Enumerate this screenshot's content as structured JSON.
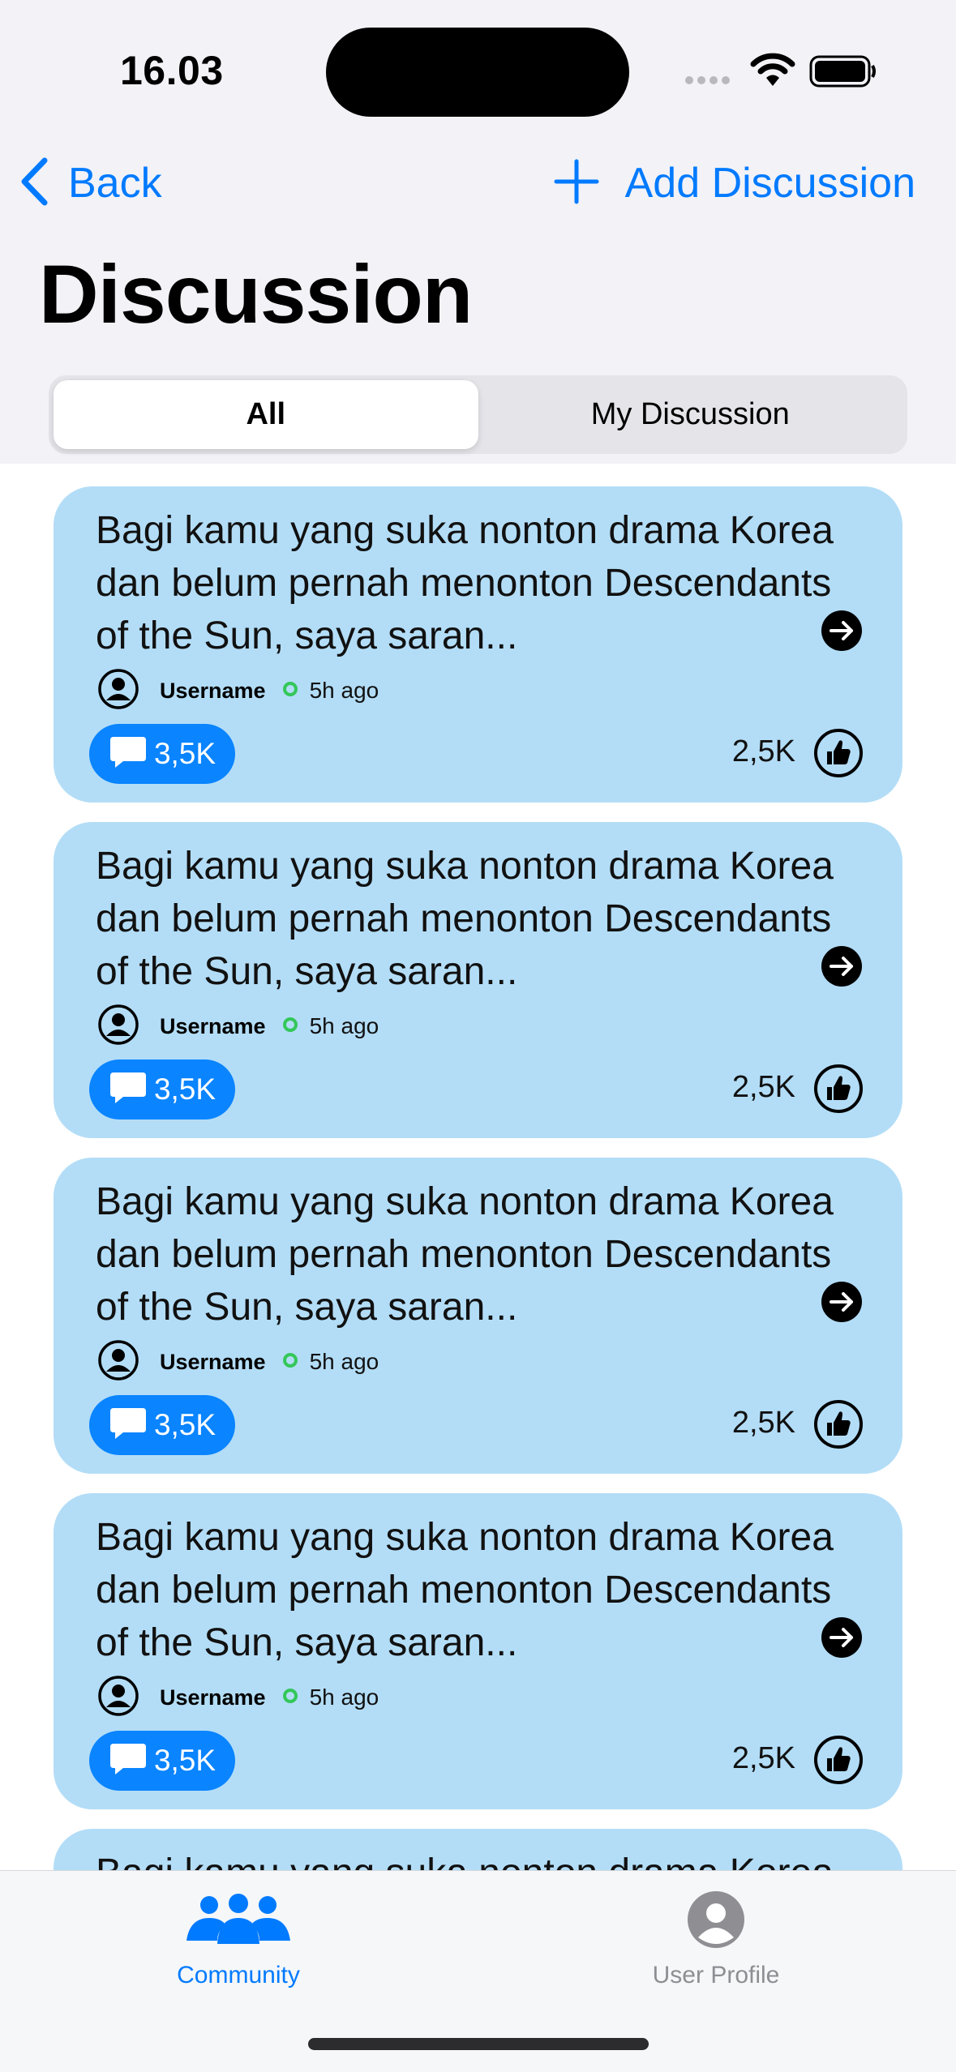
{
  "status_bar": {
    "time": "16.03"
  },
  "nav": {
    "back_label": "Back",
    "add_label": "Add Discussion",
    "title": "Discussion"
  },
  "segments": {
    "all": "All",
    "mine": "My Discussion",
    "selected": "All"
  },
  "posts": [
    {
      "text": "Bagi kamu yang suka nonton drama Korea dan belum pernah menonton Descendants of the Sun, saya saran...",
      "username": "Username",
      "time": "5h ago",
      "comments": "3,5K",
      "likes": "2,5K"
    },
    {
      "text": "Bagi kamu yang suka nonton drama Korea dan belum pernah menonton Descendants of the Sun, saya saran...",
      "username": "Username",
      "time": "5h ago",
      "comments": "3,5K",
      "likes": "2,5K"
    },
    {
      "text": "Bagi kamu yang suka nonton drama Korea dan belum pernah menonton Descendants of the Sun, saya saran...",
      "username": "Username",
      "time": "5h ago",
      "comments": "3,5K",
      "likes": "2,5K"
    },
    {
      "text": "Bagi kamu yang suka nonton drama Korea dan belum pernah menonton Descendants of the Sun, saya saran...",
      "username": "Username",
      "time": "5h ago",
      "comments": "3,5K",
      "likes": "2,5K"
    },
    {
      "text": "Bagi kamu yang suka nonton drama Korea dan belum pernah menonton Descendants of the Sun, saya saran...",
      "username": "",
      "time": "",
      "comments": "",
      "likes": ""
    }
  ],
  "tabbar": {
    "community_label": "Community",
    "profile_label": "User Profile",
    "active": "Community"
  },
  "colors": {
    "accent": "#007aff",
    "card_background": "#b3ddf7",
    "comment_pill": "#0a84ff",
    "online": "#34c759",
    "inactive_tab": "#8e8e93"
  },
  "icons": {
    "back": "chevron-left-icon",
    "add": "plus-icon",
    "open": "arrow-right-circle-icon",
    "avatar": "person-circle-icon",
    "comment": "speech-bubble-icon",
    "like": "thumbs-up-circle-icon",
    "community": "people-group-icon",
    "profile": "person-circle-fill-icon"
  }
}
